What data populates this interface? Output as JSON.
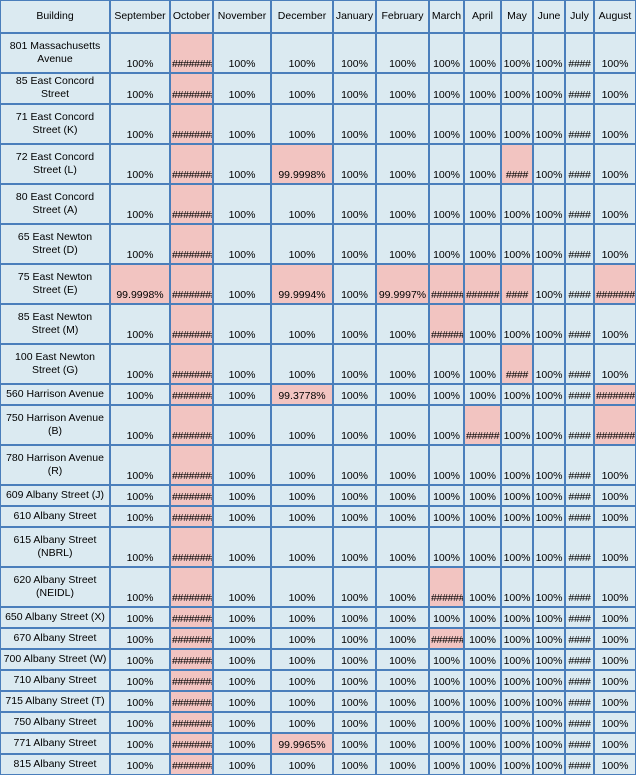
{
  "table": {
    "title": "Building",
    "columns": [
      "Building",
      "September",
      "October",
      "November",
      "December",
      "January",
      "February",
      "March",
      "April",
      "May",
      "June",
      "July",
      "August"
    ],
    "colors": {
      "cell_background": "#dbeaf1",
      "highlight_background": "#f2c4c1",
      "border": "#4a7ebb",
      "text": "#000000"
    },
    "rows": [
      {
        "building": "801 Massachusetts Avenue",
        "tall": true,
        "values": [
          "100%",
          "########",
          "100%",
          "100%",
          "100%",
          "100%",
          "100%",
          "100%",
          "100%",
          "100%",
          "####",
          "100%"
        ],
        "highlight": [
          false,
          true,
          false,
          false,
          false,
          false,
          false,
          false,
          false,
          false,
          false,
          false
        ]
      },
      {
        "building": "85 East Concord Street",
        "tall": false,
        "values": [
          "100%",
          "########",
          "100%",
          "100%",
          "100%",
          "100%",
          "100%",
          "100%",
          "100%",
          "100%",
          "####",
          "100%"
        ],
        "highlight": [
          false,
          true,
          false,
          false,
          false,
          false,
          false,
          false,
          false,
          false,
          false,
          false
        ]
      },
      {
        "building": "71 East Concord Street (K)",
        "tall": true,
        "values": [
          "100%",
          "########",
          "100%",
          "100%",
          "100%",
          "100%",
          "100%",
          "100%",
          "100%",
          "100%",
          "####",
          "100%"
        ],
        "highlight": [
          false,
          true,
          false,
          false,
          false,
          false,
          false,
          false,
          false,
          false,
          false,
          false
        ]
      },
      {
        "building": "72 East Concord Street (L)",
        "tall": true,
        "values": [
          "100%",
          "########",
          "100%",
          "99.9998%",
          "100%",
          "100%",
          "100%",
          "100%",
          "####",
          "100%",
          "####",
          "100%"
        ],
        "highlight": [
          false,
          true,
          false,
          true,
          false,
          false,
          false,
          false,
          true,
          false,
          false,
          false
        ]
      },
      {
        "building": "80 East Concord Street (A)",
        "tall": true,
        "values": [
          "100%",
          "########",
          "100%",
          "100%",
          "100%",
          "100%",
          "100%",
          "100%",
          "100%",
          "100%",
          "####",
          "100%"
        ],
        "highlight": [
          false,
          true,
          false,
          false,
          false,
          false,
          false,
          false,
          false,
          false,
          false,
          false
        ]
      },
      {
        "building": "65 East Newton Street (D)",
        "tall": true,
        "values": [
          "100%",
          "########",
          "100%",
          "100%",
          "100%",
          "100%",
          "100%",
          "100%",
          "100%",
          "100%",
          "####",
          "100%"
        ],
        "highlight": [
          false,
          true,
          false,
          false,
          false,
          false,
          false,
          false,
          false,
          false,
          false,
          false
        ]
      },
      {
        "building": "75 East Newton Street (E)",
        "tall": true,
        "values": [
          "99.9998%",
          "########",
          "100%",
          "99.9994%",
          "100%",
          "99.9997%",
          "######",
          "######",
          "####",
          "100%",
          "####",
          "########"
        ],
        "highlight": [
          true,
          true,
          false,
          true,
          false,
          true,
          true,
          true,
          true,
          false,
          false,
          true
        ]
      },
      {
        "building": "85 East Newton Street (M)",
        "tall": true,
        "values": [
          "100%",
          "########",
          "100%",
          "100%",
          "100%",
          "100%",
          "######",
          "100%",
          "100%",
          "100%",
          "####",
          "100%"
        ],
        "highlight": [
          false,
          true,
          false,
          false,
          false,
          false,
          true,
          false,
          false,
          false,
          false,
          false
        ]
      },
      {
        "building": "100 East Newton Street (G)",
        "tall": true,
        "values": [
          "100%",
          "########",
          "100%",
          "100%",
          "100%",
          "100%",
          "100%",
          "100%",
          "####",
          "100%",
          "####",
          "100%"
        ],
        "highlight": [
          false,
          true,
          false,
          false,
          false,
          false,
          false,
          false,
          true,
          false,
          false,
          false
        ]
      },
      {
        "building": "560 Harrison Avenue",
        "tall": false,
        "values": [
          "100%",
          "########",
          "100%",
          "99.3778%",
          "100%",
          "100%",
          "100%",
          "100%",
          "100%",
          "100%",
          "####",
          "########"
        ],
        "highlight": [
          false,
          true,
          false,
          true,
          false,
          false,
          false,
          false,
          false,
          false,
          false,
          true
        ]
      },
      {
        "building": "750 Harrison Avenue (B)",
        "tall": true,
        "values": [
          "100%",
          "########",
          "100%",
          "100%",
          "100%",
          "100%",
          "100%",
          "######",
          "100%",
          "100%",
          "####",
          "########"
        ],
        "highlight": [
          false,
          true,
          false,
          false,
          false,
          false,
          false,
          true,
          false,
          false,
          false,
          true
        ]
      },
      {
        "building": "780 Harrison Avenue (R)",
        "tall": true,
        "values": [
          "100%",
          "########",
          "100%",
          "100%",
          "100%",
          "100%",
          "100%",
          "100%",
          "100%",
          "100%",
          "####",
          "100%"
        ],
        "highlight": [
          false,
          true,
          false,
          false,
          false,
          false,
          false,
          false,
          false,
          false,
          false,
          false
        ]
      },
      {
        "building": "609 Albany Street (J)",
        "tall": false,
        "values": [
          "100%",
          "########",
          "100%",
          "100%",
          "100%",
          "100%",
          "100%",
          "100%",
          "100%",
          "100%",
          "####",
          "100%"
        ],
        "highlight": [
          false,
          true,
          false,
          false,
          false,
          false,
          false,
          false,
          false,
          false,
          false,
          false
        ]
      },
      {
        "building": "610 Albany Street",
        "tall": false,
        "values": [
          "100%",
          "########",
          "100%",
          "100%",
          "100%",
          "100%",
          "100%",
          "100%",
          "100%",
          "100%",
          "####",
          "100%"
        ],
        "highlight": [
          false,
          true,
          false,
          false,
          false,
          false,
          false,
          false,
          false,
          false,
          false,
          false
        ]
      },
      {
        "building": "615 Albany Street (NBRL)",
        "tall": true,
        "values": [
          "100%",
          "########",
          "100%",
          "100%",
          "100%",
          "100%",
          "100%",
          "100%",
          "100%",
          "100%",
          "####",
          "100%"
        ],
        "highlight": [
          false,
          true,
          false,
          false,
          false,
          false,
          false,
          false,
          false,
          false,
          false,
          false
        ]
      },
      {
        "building": "620 Albany Street (NEIDL)",
        "tall": true,
        "values": [
          "100%",
          "########",
          "100%",
          "100%",
          "100%",
          "100%",
          "######",
          "100%",
          "100%",
          "100%",
          "####",
          "100%"
        ],
        "highlight": [
          false,
          true,
          false,
          false,
          false,
          false,
          true,
          false,
          false,
          false,
          false,
          false
        ]
      },
      {
        "building": "650 Albany Street (X)",
        "tall": false,
        "values": [
          "100%",
          "########",
          "100%",
          "100%",
          "100%",
          "100%",
          "100%",
          "100%",
          "100%",
          "100%",
          "####",
          "100%"
        ],
        "highlight": [
          false,
          true,
          false,
          false,
          false,
          false,
          false,
          false,
          false,
          false,
          false,
          false
        ]
      },
      {
        "building": "670 Albany Street",
        "tall": false,
        "values": [
          "100%",
          "########",
          "100%",
          "100%",
          "100%",
          "100%",
          "######",
          "100%",
          "100%",
          "100%",
          "####",
          "100%"
        ],
        "highlight": [
          false,
          true,
          false,
          false,
          false,
          false,
          true,
          false,
          false,
          false,
          false,
          false
        ]
      },
      {
        "building": "700 Albany Street (W)",
        "tall": false,
        "values": [
          "100%",
          "########",
          "100%",
          "100%",
          "100%",
          "100%",
          "100%",
          "100%",
          "100%",
          "100%",
          "####",
          "100%"
        ],
        "highlight": [
          false,
          true,
          false,
          false,
          false,
          false,
          false,
          false,
          false,
          false,
          false,
          false
        ]
      },
      {
        "building": "710 Albany Street",
        "tall": false,
        "values": [
          "100%",
          "########",
          "100%",
          "100%",
          "100%",
          "100%",
          "100%",
          "100%",
          "100%",
          "100%",
          "####",
          "100%"
        ],
        "highlight": [
          false,
          true,
          false,
          false,
          false,
          false,
          false,
          false,
          false,
          false,
          false,
          false
        ]
      },
      {
        "building": "715 Albany Street (T)",
        "tall": false,
        "values": [
          "100%",
          "########",
          "100%",
          "100%",
          "100%",
          "100%",
          "100%",
          "100%",
          "100%",
          "100%",
          "####",
          "100%"
        ],
        "highlight": [
          false,
          true,
          false,
          false,
          false,
          false,
          false,
          false,
          false,
          false,
          false,
          false
        ]
      },
      {
        "building": "750 Albany Street",
        "tall": false,
        "values": [
          "100%",
          "########",
          "100%",
          "100%",
          "100%",
          "100%",
          "100%",
          "100%",
          "100%",
          "100%",
          "####",
          "100%"
        ],
        "highlight": [
          false,
          true,
          false,
          false,
          false,
          false,
          false,
          false,
          false,
          false,
          false,
          false
        ]
      },
      {
        "building": "771 Albany Street",
        "tall": false,
        "values": [
          "100%",
          "########",
          "100%",
          "99.9965%",
          "100%",
          "100%",
          "100%",
          "100%",
          "100%",
          "100%",
          "####",
          "100%"
        ],
        "highlight": [
          false,
          true,
          false,
          true,
          false,
          false,
          false,
          false,
          false,
          false,
          false,
          false
        ]
      },
      {
        "building": "815 Albany Street",
        "tall": false,
        "values": [
          "100%",
          "########",
          "100%",
          "100%",
          "100%",
          "100%",
          "100%",
          "100%",
          "100%",
          "100%",
          "####",
          "100%"
        ],
        "highlight": [
          false,
          true,
          false,
          false,
          false,
          false,
          false,
          false,
          false,
          false,
          false,
          false
        ]
      }
    ]
  }
}
